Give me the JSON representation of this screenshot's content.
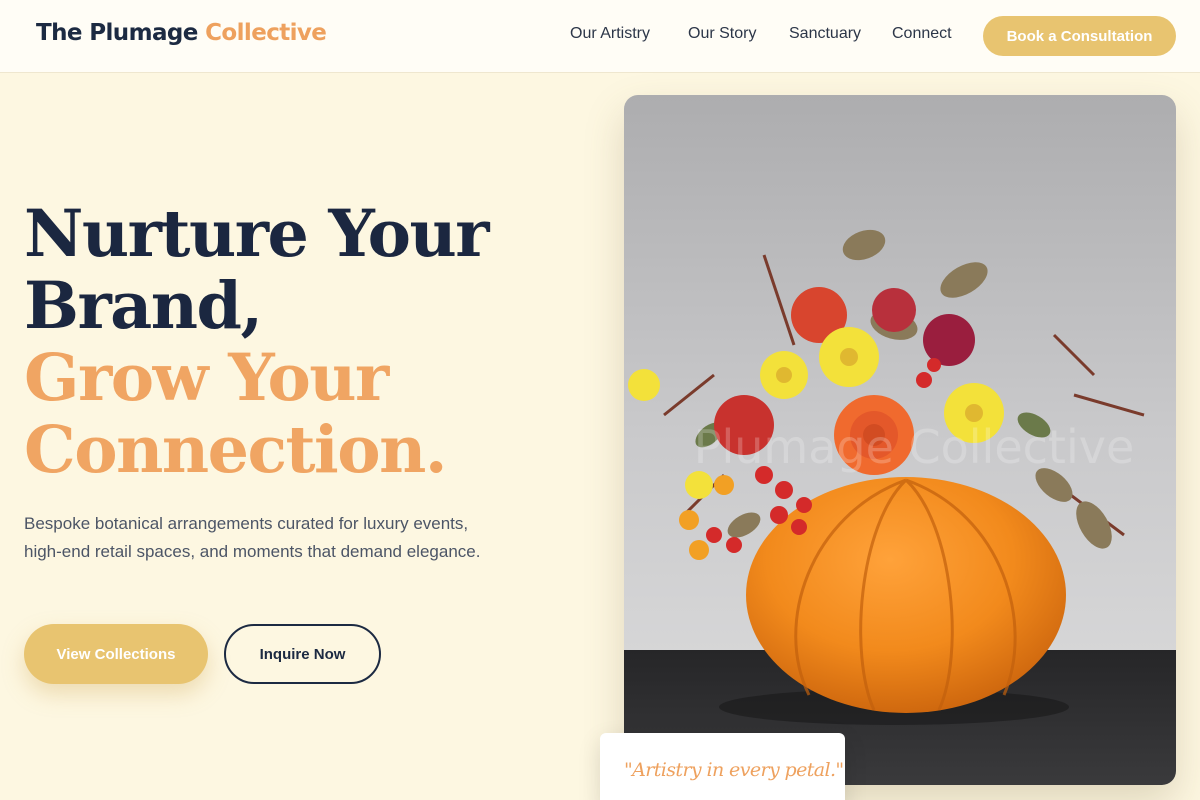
{
  "header": {
    "brand_main": "The Plumage ",
    "brand_accent": "Collective",
    "nav": [
      "Our Artistry",
      "Our Story",
      "Sanctuary",
      "Connect"
    ],
    "cta_label": "Book a Consultation"
  },
  "hero": {
    "title_line1": "Nurture Your",
    "title_line2": "Brand,",
    "title_line3": "Grow Your",
    "title_line4": "Connection.",
    "subtitle": "Bespoke botanical arrangements curated for luxury events, high-end retail spaces, and moments that demand elegance.",
    "primary_button": "View Collections",
    "secondary_button": "Inquire Now",
    "image_watermark": "Plumage Collective",
    "quote": "\"Artistry in every petal.\""
  },
  "colors": {
    "background": "#fdf7e1",
    "navy": "#1c2a42",
    "accent_orange": "#eea15e",
    "accent_gold": "#e8c470"
  }
}
